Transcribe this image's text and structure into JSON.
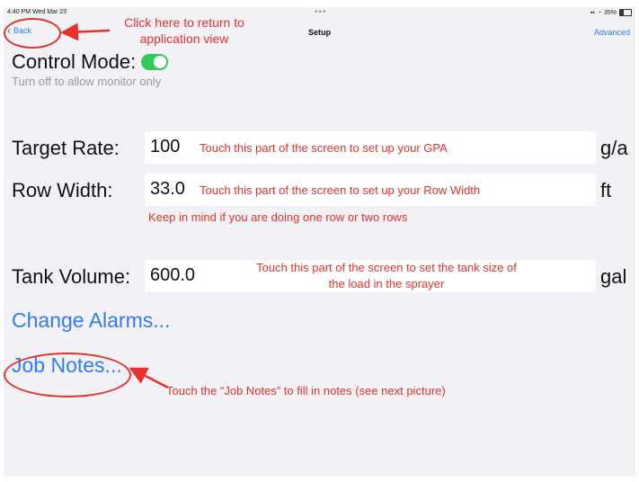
{
  "status": {
    "time": "4:40 PM  Wed Mar 23",
    "dots": "•••",
    "battery_text": "35%"
  },
  "nav": {
    "back_label": "Back",
    "title": "Setup",
    "advanced_label": "Advanced"
  },
  "control_mode": {
    "label": "Control Mode:",
    "enabled": true,
    "hint": "Turn off to allow monitor only"
  },
  "fields": {
    "target_rate": {
      "label": "Target Rate:",
      "value": "100",
      "unit": "g/a"
    },
    "row_width": {
      "label": "Row Width:",
      "value": "33.0",
      "unit": "ft"
    },
    "tank_volume": {
      "label": "Tank Volume:",
      "value": "600.0",
      "unit": "gal"
    }
  },
  "links": {
    "change_alarms": "Change Alarms...",
    "job_notes": "Job Notes..."
  },
  "annotations": {
    "back": "Click here to return to\napplication view",
    "target_rate": "Touch this part of the screen to set up your GPA",
    "row_width": "Touch this part of the screen to set up your Row Width",
    "row_note": "Keep in mind if you are doing one row or two rows",
    "tank_volume": "Touch this part of the screen to set the tank size of\nthe load in the sprayer",
    "job_notes": "Touch the “Job Notes” to fill in notes (see next picture)"
  },
  "colors": {
    "accent": "#2f7cf6",
    "annotation": "#e8322b",
    "toggle_on": "#34c759",
    "background": "#f2f2f6"
  }
}
